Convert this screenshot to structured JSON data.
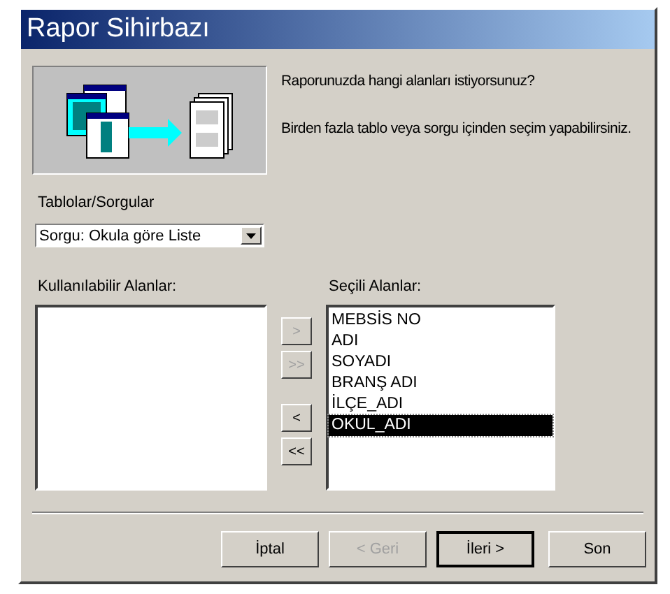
{
  "window": {
    "title": "Rapor Sihirbazı"
  },
  "intro": {
    "question": "Raporunuzda hangi alanları istiyorsunuz?",
    "hint": "Birden fazla tablo veya sorgu içinden seçim yapabilirsiniz."
  },
  "source": {
    "label": "Tablolar/Sorgular",
    "value": "Sorgu: Okula göre Liste"
  },
  "available": {
    "label": "Kullanılabilir Alanlar:"
  },
  "transfer_buttons": [
    {
      "label": ">",
      "disabled": true
    },
    {
      "label": ">>",
      "disabled": true
    },
    {
      "label": "<",
      "disabled": false
    },
    {
      "label": "<<",
      "disabled": false
    }
  ],
  "selected_fields": {
    "label": "Seçili Alanlar:",
    "items": [
      {
        "label": "MEBSİS NO",
        "selected": false
      },
      {
        "label": "ADI",
        "selected": false
      },
      {
        "label": "SOYADI",
        "selected": false
      },
      {
        "label": "BRANŞ ADI",
        "selected": false
      },
      {
        "label": "İLÇE_ADI",
        "selected": false
      },
      {
        "label": "OKUL_ADI",
        "selected": true
      }
    ]
  },
  "buttons": [
    {
      "label": "İptal",
      "disabled": false,
      "default": false
    },
    {
      "label": "< Geri",
      "disabled": true,
      "default": false
    },
    {
      "label": "İleri >",
      "disabled": false,
      "default": true
    },
    {
      "label": "Son",
      "disabled": false,
      "default": false
    }
  ]
}
